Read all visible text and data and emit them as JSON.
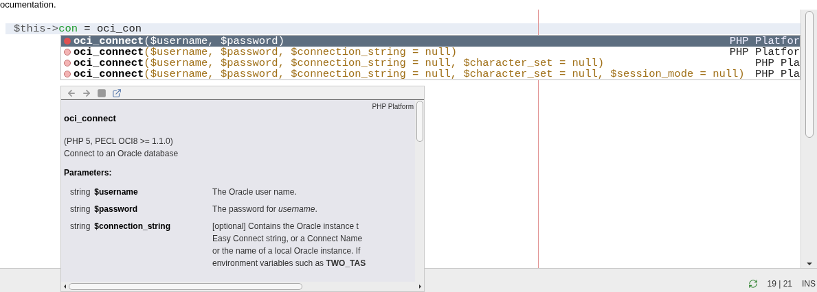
{
  "page_heading": "ocumentation.",
  "editor": {
    "code_line": [
      {
        "kind": "variable",
        "text": "$this->"
      },
      {
        "kind": "field",
        "text": "con"
      },
      {
        "kind": "plain",
        "text": " = oci_con"
      }
    ]
  },
  "completion": {
    "items": [
      {
        "name": "oci_connect",
        "args": "($username, $password)",
        "source": "PHP Platfor",
        "selected": true
      },
      {
        "name": "oci_connect",
        "args": "($username, $password, $connection_string = null)",
        "source": "PHP Platfor",
        "selected": false
      },
      {
        "name": "oci_connect",
        "args": "($username, $password, $connection_string = null, $character_set = null)",
        "source": "PHP Pla",
        "selected": false
      },
      {
        "name": "oci_connect",
        "args": "($username, $password, $connection_string = null, $character_set = null, $session_mode = null)",
        "source": "PHP Pla",
        "selected": false
      }
    ]
  },
  "doc": {
    "source": "PHP Platform",
    "title": "oci_connect",
    "versions": "(PHP 5, PECL OCI8 >= 1.1.0)",
    "summary": "Connect to an Oracle database",
    "parameters_heading": "Parameters:",
    "parameters": [
      {
        "type": "string",
        "name": "$username",
        "lines": [
          "The Oracle user name."
        ]
      },
      {
        "type": "string",
        "name": "$password",
        "lines": [
          "The password for *username*."
        ]
      },
      {
        "type": "string",
        "name": "$connection_string",
        "lines": [
          "[optional] Contains the Oracle instance t",
          "Easy Connect string, or a Connect Name",
          "or the name of a local Oracle instance. If",
          "environment variables such as **TWO_TAS**"
        ]
      }
    ]
  },
  "status_bar": {
    "position": "19 | 21",
    "mode": "INS"
  }
}
